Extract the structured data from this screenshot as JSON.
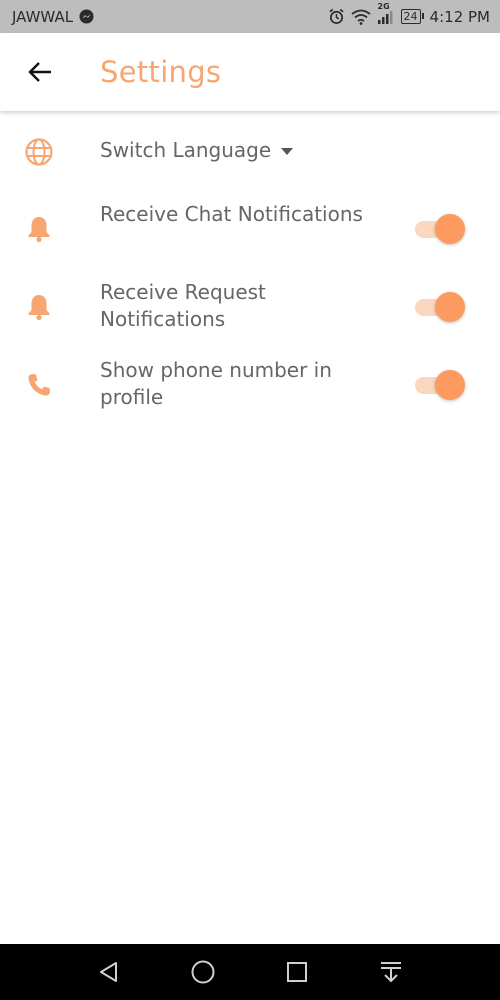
{
  "status_bar": {
    "carrier": "JAWWAL",
    "network_type": "2G",
    "battery_level": "24",
    "time": "4:12 PM",
    "icons": [
      "messenger-icon",
      "alarm-icon",
      "wifi-icon",
      "signal-icon",
      "battery-icon"
    ]
  },
  "app_bar": {
    "title": "Settings",
    "back_icon": "arrow-left-icon"
  },
  "settings": {
    "language": {
      "label": "Switch Language",
      "icon": "globe-icon"
    },
    "items": [
      {
        "label": "Receive Chat Notifications",
        "icon": "bell-icon",
        "enabled": true
      },
      {
        "label": "Receive Request Notifications",
        "icon": "bell-icon",
        "enabled": true
      },
      {
        "label": "Show phone number in profile",
        "icon": "phone-icon",
        "enabled": true
      }
    ]
  },
  "nav_bar": {
    "icons": [
      "back-triangle-icon",
      "home-circle-icon",
      "recents-square-icon",
      "notification-pull-icon"
    ]
  },
  "colors": {
    "accent": "#f7a571",
    "toggle_thumb": "#fd9a5f",
    "toggle_track": "#fbd7bf",
    "label_text": "#666666",
    "status_bar_bg": "#bdbdbd",
    "nav_bar_bg": "#000000"
  }
}
